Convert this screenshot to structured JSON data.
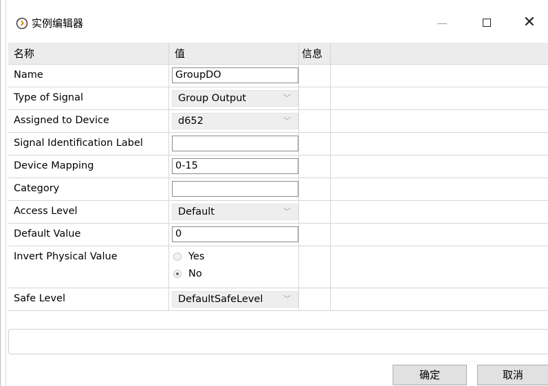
{
  "window": {
    "title": "实例编辑器",
    "icon": "app-icon",
    "close_glyph": "✕"
  },
  "table": {
    "headers": {
      "name": "名称",
      "value": "值",
      "info": "信息"
    },
    "rows": {
      "name": {
        "label": "Name",
        "value": "GroupDO"
      },
      "type_of_signal": {
        "label": "Type of Signal",
        "value": "Group Output"
      },
      "assigned_to_device": {
        "label": "Assigned to Device",
        "value": "d652"
      },
      "signal_identification_label": {
        "label": "Signal Identification Label",
        "value": ""
      },
      "device_mapping": {
        "label": "Device Mapping",
        "value": "0-15"
      },
      "category": {
        "label": "Category",
        "value": ""
      },
      "access_level": {
        "label": "Access Level",
        "value": "Default"
      },
      "default_value": {
        "label": "Default Value",
        "value": "0"
      },
      "invert_physical_value": {
        "label": "Invert Physical Value",
        "options": [
          "Yes",
          "No"
        ],
        "selected": "No"
      },
      "safe_level": {
        "label": "Safe Level",
        "value": "DefaultSafeLevel"
      }
    }
  },
  "buttons": {
    "ok": "确定",
    "cancel": "取消"
  },
  "dropdown_chevron": "﹀",
  "colors": {
    "header_bg": "#ececec",
    "grid_line": "#d6d6d6",
    "button_bg": "#e1e1e1"
  }
}
